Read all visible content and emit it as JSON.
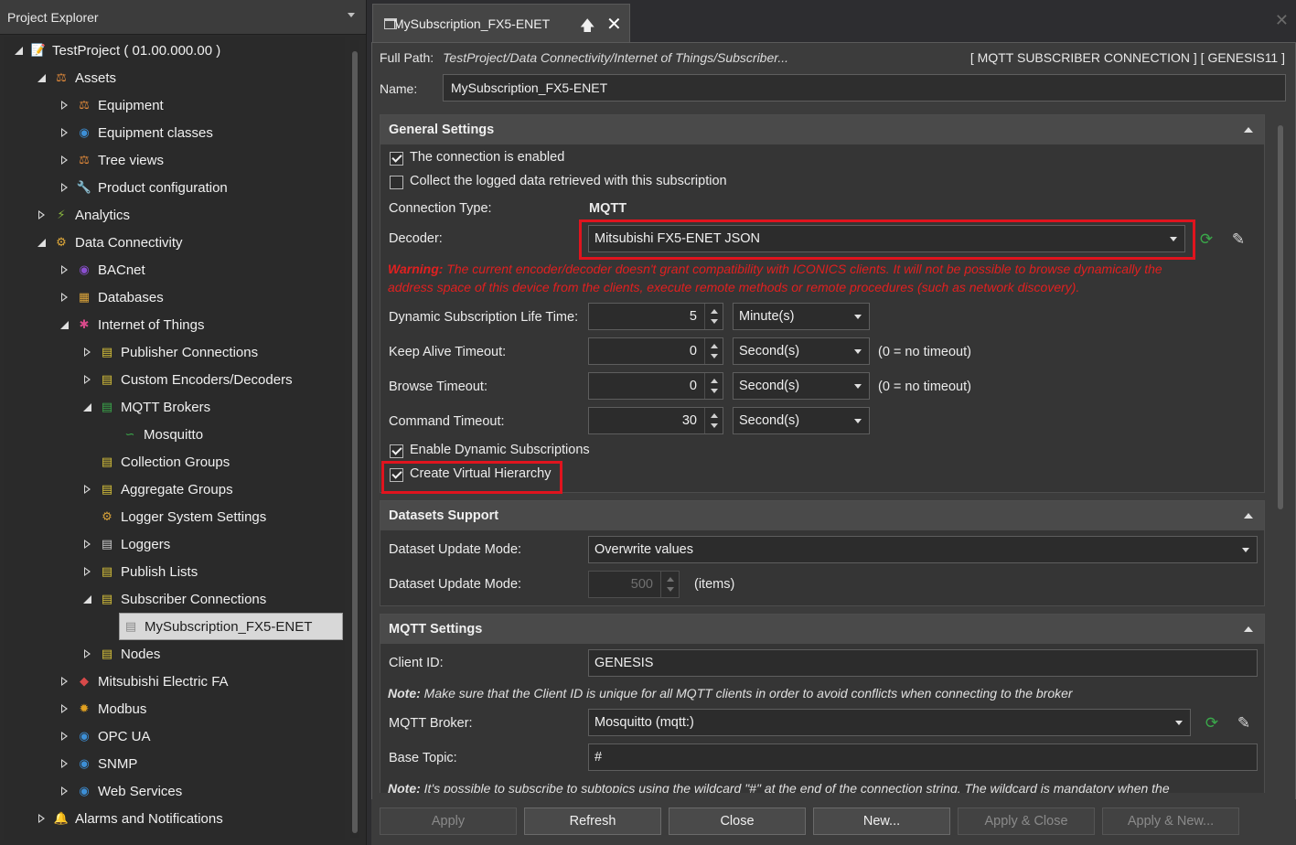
{
  "explorer": {
    "title": "Project Explorer",
    "tree": [
      {
        "label": "TestProject ( 01.00.000.00 )",
        "depth": 0,
        "state": "expanded",
        "icon": "project-icon",
        "color": "#d9d9d9"
      },
      {
        "label": "Assets",
        "depth": 1,
        "state": "expanded",
        "icon": "assets-icon",
        "color": "#e0893a"
      },
      {
        "label": "Equipment",
        "depth": 2,
        "state": "collapsed",
        "icon": "equipment-icon",
        "color": "#e0893a"
      },
      {
        "label": "Equipment classes",
        "depth": 2,
        "state": "collapsed",
        "icon": "equipment-classes-icon",
        "color": "#3d8fd6"
      },
      {
        "label": "Tree views",
        "depth": 2,
        "state": "collapsed",
        "icon": "tree-views-icon",
        "color": "#e0893a"
      },
      {
        "label": "Product configuration",
        "depth": 2,
        "state": "collapsed",
        "icon": "wrench-icon",
        "color": "#c8c8c8"
      },
      {
        "label": "Analytics",
        "depth": 1,
        "state": "collapsed",
        "icon": "analytics-icon",
        "color": "#8ab83e"
      },
      {
        "label": "Data Connectivity",
        "depth": 1,
        "state": "expanded",
        "icon": "gears-icon",
        "color": "#e0a93a"
      },
      {
        "label": "BACnet",
        "depth": 2,
        "state": "collapsed",
        "icon": "bacnet-icon",
        "color": "#8a4fd0"
      },
      {
        "label": "Databases",
        "depth": 2,
        "state": "collapsed",
        "icon": "database-icon",
        "color": "#d8a23a"
      },
      {
        "label": "Internet of Things",
        "depth": 2,
        "state": "expanded",
        "icon": "iot-icon",
        "color": "#d84a8a"
      },
      {
        "label": "Publisher Connections",
        "depth": 3,
        "state": "collapsed",
        "icon": "publisher-icon",
        "color": "#d8c23a"
      },
      {
        "label": "Custom Encoders/Decoders",
        "depth": 3,
        "state": "collapsed",
        "icon": "encoder-icon",
        "color": "#d8c23a"
      },
      {
        "label": "MQTT Brokers",
        "depth": 3,
        "state": "expanded",
        "icon": "broker-icon",
        "color": "#3aa84a"
      },
      {
        "label": "Mosquitto",
        "depth": 4,
        "state": "none",
        "icon": "rss-icon",
        "color": "#3aa84a"
      },
      {
        "label": "Collection Groups",
        "depth": 3,
        "state": "none",
        "icon": "collection-icon",
        "color": "#d8c23a"
      },
      {
        "label": "Aggregate Groups",
        "depth": 3,
        "state": "collapsed",
        "icon": "aggregate-icon",
        "color": "#d8c23a"
      },
      {
        "label": "Logger System Settings",
        "depth": 3,
        "state": "none",
        "icon": "settings-icon",
        "color": "#d8a23a"
      },
      {
        "label": "Loggers",
        "depth": 3,
        "state": "collapsed",
        "icon": "loggers-icon",
        "color": "#c8c8c8"
      },
      {
        "label": "Publish Lists",
        "depth": 3,
        "state": "collapsed",
        "icon": "list-icon",
        "color": "#d8c23a"
      },
      {
        "label": "Subscriber Connections",
        "depth": 3,
        "state": "expanded",
        "icon": "subscriber-icon",
        "color": "#d8c23a"
      },
      {
        "label": "MySubscription_FX5-ENET",
        "depth": 4,
        "state": "none",
        "icon": "subscription-icon",
        "color": "#8a8a8a",
        "selected": true
      },
      {
        "label": "Nodes",
        "depth": 3,
        "state": "collapsed",
        "icon": "nodes-icon",
        "color": "#d8c23a"
      },
      {
        "label": "Mitsubishi Electric FA",
        "depth": 2,
        "state": "collapsed",
        "icon": "mitsubishi-icon",
        "color": "#d84a4a"
      },
      {
        "label": "Modbus",
        "depth": 2,
        "state": "collapsed",
        "icon": "modbus-icon",
        "color": "#e0a020"
      },
      {
        "label": "OPC UA",
        "depth": 2,
        "state": "collapsed",
        "icon": "opcua-icon",
        "color": "#3d8fd6"
      },
      {
        "label": "SNMP",
        "depth": 2,
        "state": "collapsed",
        "icon": "snmp-icon",
        "color": "#3d8fd6"
      },
      {
        "label": "Web Services",
        "depth": 2,
        "state": "collapsed",
        "icon": "web-services-icon",
        "color": "#3d8fd6"
      },
      {
        "label": "Alarms and Notifications",
        "depth": 1,
        "state": "collapsed",
        "icon": "bell-icon",
        "color": "#e0a020"
      }
    ]
  },
  "tab": {
    "title": "MySubscription_FX5-ENET"
  },
  "header": {
    "full_path_label": "Full Path:",
    "full_path_value": "TestProject/Data Connectivity/Internet of Things/Subscriber...",
    "type_tags": "[ MQTT SUBSCRIBER CONNECTION ] [ GENESIS11 ]",
    "name_label": "Name:",
    "name_value": "MySubscription_FX5-ENET"
  },
  "general": {
    "title": "General Settings",
    "enabled_label": "The connection is enabled",
    "enabled": true,
    "collect_label": "Collect the logged data retrieved with this subscription",
    "collect": false,
    "conn_type_label": "Connection Type:",
    "conn_type_value": "MQTT",
    "decoder_label": "Decoder:",
    "decoder_value": "Mitsubishi FX5-ENET JSON",
    "warning_prefix": "Warning:",
    "warning_line1": " The current encoder/decoder doesn't grant compatibility with ICONICS clients. It will not be possible to browse dynamically the",
    "warning_line2": "address space of this device from the clients, execute remote methods or remote procedures (such as network discovery).",
    "dyn_life_label": "Dynamic Subscription Life Time:",
    "dyn_life_value": "5",
    "dyn_life_unit": "Minute(s)",
    "keepalive_label": "Keep Alive Timeout:",
    "keepalive_value": "0",
    "keepalive_unit": "Second(s)",
    "keepalive_hint": "(0 = no timeout)",
    "browse_label": "Browse Timeout:",
    "browse_value": "0",
    "browse_unit": "Second(s)",
    "browse_hint": "(0 = no timeout)",
    "command_label": "Command Timeout:",
    "command_value": "30",
    "command_unit": "Second(s)",
    "enable_dyn_label": "Enable Dynamic Subscriptions",
    "enable_dyn": true,
    "virtual_label": "Create Virtual Hierarchy",
    "virtual": true
  },
  "datasets": {
    "title": "Datasets Support",
    "mode_label": "Dataset Update Mode:",
    "mode_value": "Overwrite values",
    "mode2_label": "Dataset Update Mode:",
    "mode2_value": "500",
    "mode2_unit": "(items)"
  },
  "mqtt": {
    "title": "MQTT Settings",
    "client_label": "Client ID:",
    "client_value": "GENESIS",
    "client_note_prefix": "Note:",
    "client_note": " Make sure that the Client ID is unique for all MQTT clients in order to avoid conflicts when connecting to the broker",
    "broker_label": "MQTT Broker:",
    "broker_value": "Mosquitto  (mqtt:)",
    "topic_label": "Base Topic:",
    "topic_value": "#",
    "topic_note_prefix": "Note:",
    "topic_note": " It's possible to subscribe to subtopics using the wildcard \"#\" at the end of the connection string. The wildcard is mandatory when the"
  },
  "footer": {
    "apply": "Apply",
    "refresh": "Refresh",
    "close": "Close",
    "new": "New...",
    "apply_close": "Apply & Close",
    "apply_new": "Apply & New..."
  },
  "colors": {
    "highlight": "#e0141e",
    "warning": "#e02020",
    "background": "#2d2d30"
  }
}
